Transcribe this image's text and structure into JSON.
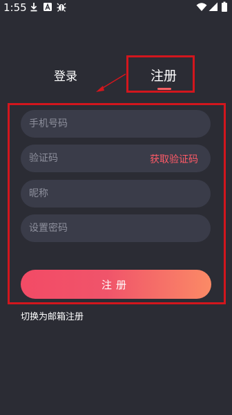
{
  "status_bar": {
    "time": "1:55",
    "icons": [
      "download-icon",
      "app-a-icon",
      "bug-app-icon",
      "wifi-icon",
      "signal-icon",
      "battery-icon"
    ]
  },
  "tabs": {
    "login_label": "登录",
    "register_label": "注册",
    "active": "register"
  },
  "form": {
    "phone_placeholder": "手机号码",
    "code_placeholder": "验证码",
    "get_code_label": "获取验证码",
    "nickname_placeholder": "昵称",
    "password_placeholder": "设置密码",
    "submit_label": "注册"
  },
  "switch_email_label": "切换为邮箱注册",
  "colors": {
    "background": "#2b2c34",
    "field": "#3a3c49",
    "accent": "#ff5a67",
    "gradient_start": "#f34b66",
    "gradient_end": "#fb8a66",
    "annotation": "#d3161d"
  }
}
